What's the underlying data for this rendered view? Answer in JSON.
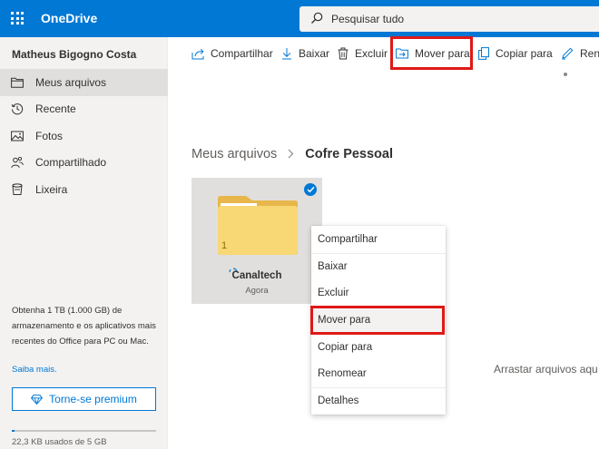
{
  "app": {
    "brand": "OneDrive"
  },
  "search": {
    "placeholder": "Pesquisar tudo"
  },
  "sidebar": {
    "user_name": "Matheus Bigogno Costa",
    "items": [
      {
        "label": "Meus arquivos",
        "icon": "folder-icon",
        "active": true
      },
      {
        "label": "Recente",
        "icon": "clock-icon",
        "active": false
      },
      {
        "label": "Fotos",
        "icon": "image-icon",
        "active": false
      },
      {
        "label": "Compartilhado",
        "icon": "people-icon",
        "active": false
      },
      {
        "label": "Lixeira",
        "icon": "trash-icon",
        "active": false
      }
    ],
    "promo_text": "Obtenha 1 TB (1.000 GB) de armazenamento e os aplicativos mais recentes do Office para PC ou Mac.",
    "promo_link": "Saiba mais.",
    "premium_button": "Torne-se premium",
    "storage_text": "22,3 KB usados de 5 GB",
    "storage_fraction": 0.02
  },
  "commands": [
    {
      "label": "Compartilhar",
      "icon": "share-icon"
    },
    {
      "label": "Baixar",
      "icon": "download-icon"
    },
    {
      "label": "Excluir",
      "icon": "delete-icon"
    },
    {
      "label": "Mover para",
      "icon": "move-icon",
      "highlighted": true
    },
    {
      "label": "Copiar para",
      "icon": "copy-icon"
    },
    {
      "label": "Reno",
      "icon": "rename-icon"
    }
  ],
  "breadcrumb": {
    "parent": "Meus arquivos",
    "current": "Cofre Pessoal"
  },
  "tile": {
    "name": "Canaltech",
    "date": "Agora",
    "count": "1",
    "selected": true
  },
  "context_menu": [
    {
      "label": "Compartilhar"
    },
    {
      "label": "Baixar"
    },
    {
      "label": "Excluir"
    },
    {
      "label": "Mover para",
      "highlighted": true
    },
    {
      "label": "Copiar para"
    },
    {
      "label": "Renomear"
    },
    {
      "label": "Detalhes"
    }
  ],
  "drop_hint": "Arrastar arquivos aqu",
  "colors": {
    "brand": "#0078d4",
    "highlight": "#e01818",
    "folder": "#f8d775"
  }
}
